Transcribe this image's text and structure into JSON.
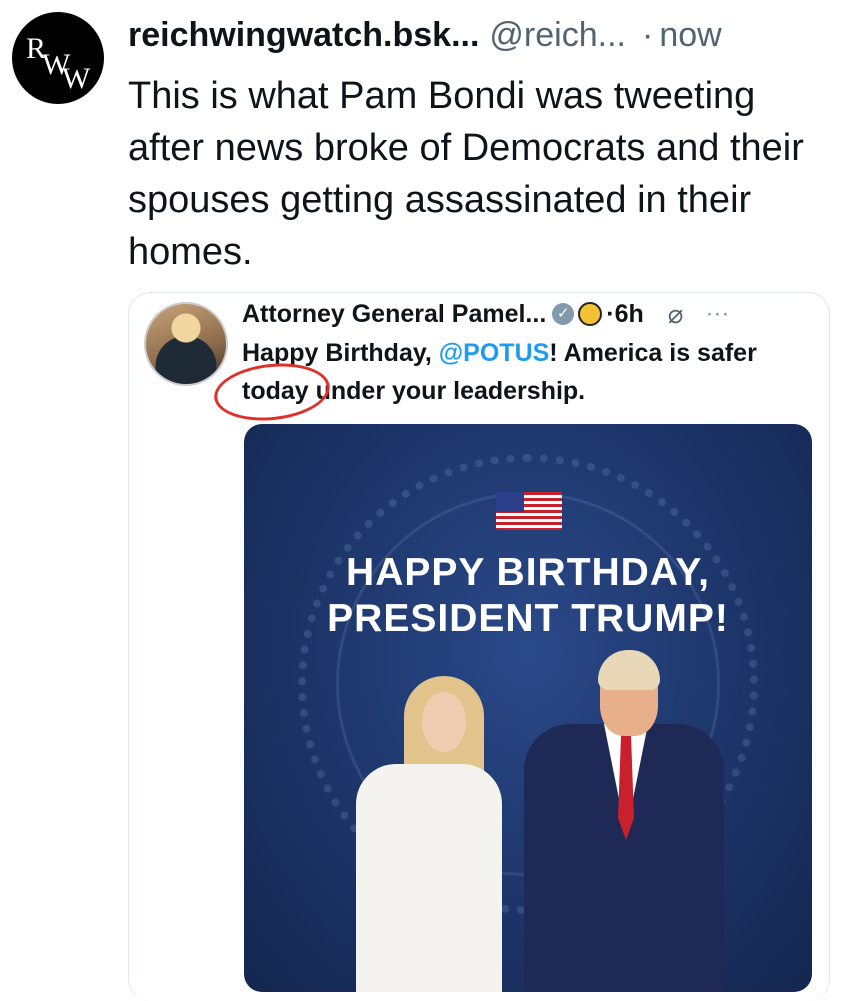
{
  "post": {
    "avatar_text": "RWW",
    "author_name": "reichwingwatch.bsk...",
    "handle": "@reich...",
    "separator": "·",
    "time": "now",
    "text": "This is what Pam Bondi was tweeting after news broke of Democrats and their spouses getting assassinated in their homes."
  },
  "quoted_post": {
    "author_name": "Attorney General Pamel...",
    "time": "·6h",
    "text_part1": "Happy Birthday, ",
    "mention": "@POTUS",
    "text_part2": "! America is safer today under your leadership.",
    "image": {
      "title_line1": "HAPPY BIRTHDAY,",
      "title_line2": "PRESIDENT TRUMP!"
    }
  },
  "icons": {
    "verified": "verified-check-icon",
    "affiliation": "doj-seal-badge-icon",
    "grok": "grok-icon",
    "more": "more-options-icon",
    "annotation": "red-circle-annotation"
  },
  "colors": {
    "mention": "#1d9bf0",
    "annotation": "#e0302a",
    "image_background": "#1c3468"
  }
}
